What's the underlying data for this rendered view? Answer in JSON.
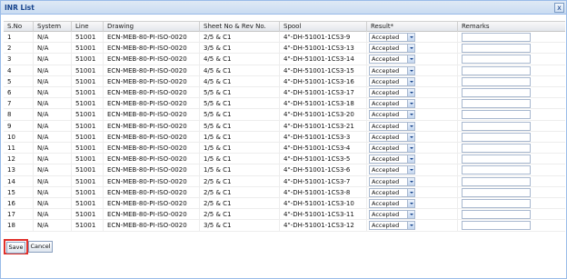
{
  "window": {
    "title": "INR List",
    "close_label": "x"
  },
  "columns": [
    "S.No",
    "System",
    "Line",
    "Drawing",
    "Sheet No & Rev No.",
    "Spool",
    "Result*",
    "Remarks"
  ],
  "rows": [
    {
      "sno": "1",
      "system": "N/A",
      "line": "51001",
      "drawing": "ECN-MEB-80-PI-ISO-0020",
      "sheet": "2/5 & C1",
      "spool": "4\"-DH-51001-1CS3-9",
      "result": "Accepted",
      "remarks": ""
    },
    {
      "sno": "2",
      "system": "N/A",
      "line": "51001",
      "drawing": "ECN-MEB-80-PI-ISO-0020",
      "sheet": "3/5 & C1",
      "spool": "4\"-DH-51001-1CS3-13",
      "result": "Accepted",
      "remarks": ""
    },
    {
      "sno": "3",
      "system": "N/A",
      "line": "51001",
      "drawing": "ECN-MEB-80-PI-ISO-0020",
      "sheet": "4/5 & C1",
      "spool": "4\"-DH-51001-1CS3-14",
      "result": "Accepted",
      "remarks": ""
    },
    {
      "sno": "4",
      "system": "N/A",
      "line": "51001",
      "drawing": "ECN-MEB-80-PI-ISO-0020",
      "sheet": "4/5 & C1",
      "spool": "4\"-DH-51001-1CS3-15",
      "result": "Accepted",
      "remarks": ""
    },
    {
      "sno": "5",
      "system": "N/A",
      "line": "51001",
      "drawing": "ECN-MEB-80-PI-ISO-0020",
      "sheet": "4/5 & C1",
      "spool": "4\"-DH-51001-1CS3-16",
      "result": "Accepted",
      "remarks": ""
    },
    {
      "sno": "6",
      "system": "N/A",
      "line": "51001",
      "drawing": "ECN-MEB-80-PI-ISO-0020",
      "sheet": "5/5 & C1",
      "spool": "4\"-DH-51001-1CS3-17",
      "result": "Accepted",
      "remarks": ""
    },
    {
      "sno": "7",
      "system": "N/A",
      "line": "51001",
      "drawing": "ECN-MEB-80-PI-ISO-0020",
      "sheet": "5/5 & C1",
      "spool": "4\"-DH-51001-1CS3-18",
      "result": "Accepted",
      "remarks": ""
    },
    {
      "sno": "8",
      "system": "N/A",
      "line": "51001",
      "drawing": "ECN-MEB-80-PI-ISO-0020",
      "sheet": "5/5 & C1",
      "spool": "4\"-DH-51001-1CS3-20",
      "result": "Accepted",
      "remarks": ""
    },
    {
      "sno": "9",
      "system": "N/A",
      "line": "51001",
      "drawing": "ECN-MEB-80-PI-ISO-0020",
      "sheet": "5/5 & C1",
      "spool": "4\"-DH-51001-1CS3-21",
      "result": "Accepted",
      "remarks": ""
    },
    {
      "sno": "10",
      "system": "N/A",
      "line": "51001",
      "drawing": "ECN-MEB-80-PI-ISO-0020",
      "sheet": "1/5 & C1",
      "spool": "4\"-DH-51001-1CS3-3",
      "result": "Accepted",
      "remarks": ""
    },
    {
      "sno": "11",
      "system": "N/A",
      "line": "51001",
      "drawing": "ECN-MEB-80-PI-ISO-0020",
      "sheet": "1/5 & C1",
      "spool": "4\"-DH-51001-1CS3-4",
      "result": "Accepted",
      "remarks": ""
    },
    {
      "sno": "12",
      "system": "N/A",
      "line": "51001",
      "drawing": "ECN-MEB-80-PI-ISO-0020",
      "sheet": "1/5 & C1",
      "spool": "4\"-DH-51001-1CS3-5",
      "result": "Accepted",
      "remarks": ""
    },
    {
      "sno": "13",
      "system": "N/A",
      "line": "51001",
      "drawing": "ECN-MEB-80-PI-ISO-0020",
      "sheet": "1/5 & C1",
      "spool": "4\"-DH-51001-1CS3-6",
      "result": "Accepted",
      "remarks": ""
    },
    {
      "sno": "14",
      "system": "N/A",
      "line": "51001",
      "drawing": "ECN-MEB-80-PI-ISO-0020",
      "sheet": "2/5 & C1",
      "spool": "4\"-DH-51001-1CS3-7",
      "result": "Accepted",
      "remarks": ""
    },
    {
      "sno": "15",
      "system": "N/A",
      "line": "51001",
      "drawing": "ECN-MEB-80-PI-ISO-0020",
      "sheet": "2/5 & C1",
      "spool": "4\"-DH-51001-1CS3-8",
      "result": "Accepted",
      "remarks": ""
    },
    {
      "sno": "16",
      "system": "N/A",
      "line": "51001",
      "drawing": "ECN-MEB-80-PI-ISO-0020",
      "sheet": "2/5 & C1",
      "spool": "4\"-DH-51001-1CS3-10",
      "result": "Accepted",
      "remarks": ""
    },
    {
      "sno": "17",
      "system": "N/A",
      "line": "51001",
      "drawing": "ECN-MEB-80-PI-ISO-0020",
      "sheet": "2/5 & C1",
      "spool": "4\"-DH-51001-1CS3-11",
      "result": "Accepted",
      "remarks": ""
    },
    {
      "sno": "18",
      "system": "N/A",
      "line": "51001",
      "drawing": "ECN-MEB-80-PI-ISO-0020",
      "sheet": "3/5 & C1",
      "spool": "4\"-DH-51001-1CS3-12",
      "result": "Accepted",
      "remarks": ""
    }
  ],
  "buttons": {
    "save_label": "Save",
    "cancel_label": "Cancel"
  },
  "colors": {
    "accent": "#15428b",
    "highlight_border": "#e0302b"
  }
}
